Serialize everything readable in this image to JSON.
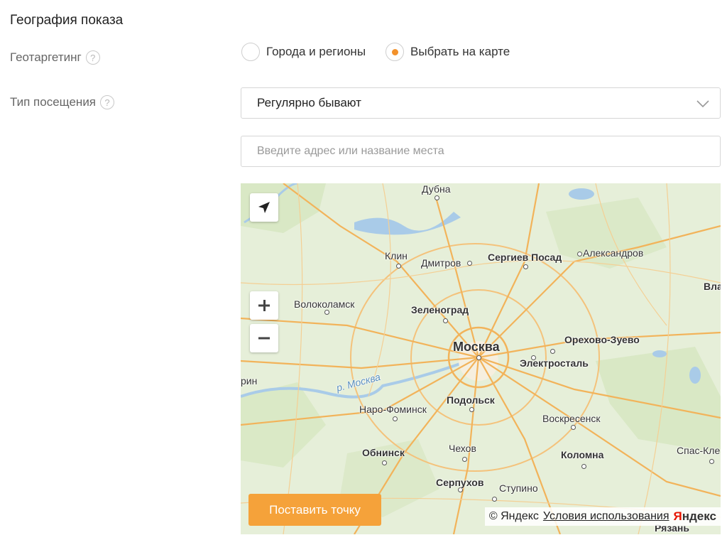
{
  "section": {
    "title": "География показа"
  },
  "geotargeting": {
    "label": "Геотаргетинг",
    "help": "?",
    "options": [
      {
        "label": "Города и регионы",
        "checked": false
      },
      {
        "label": "Выбрать на карте",
        "checked": true
      }
    ]
  },
  "visit_type": {
    "label": "Тип посещения",
    "help": "?",
    "selected": "Регулярно бывают"
  },
  "address": {
    "placeholder": "Введите адрес или название места",
    "value": ""
  },
  "map": {
    "place_point_label": "Поставить точку",
    "attribution_prefix": "© Яндекс",
    "terms_link": "Условия использования",
    "logo_first": "Я",
    "logo_rest": "ндекс",
    "river_label": "р. Москва",
    "cities": {
      "dubna": "Дубна",
      "klin": "Клин",
      "dmitrov": "Дмитров",
      "sergiev_posad": "Сергиев Посад",
      "aleksandrov": "Александров",
      "vla": "Вла",
      "volokolamsk": "Волоколамск",
      "zelenograd": "Зеленоград",
      "moskva": "Москва",
      "orekhovo": "Орехово-Зуево",
      "elektrostal": "Электросталь",
      "rin": "рин",
      "naro": "Наро-Фоминск",
      "podolsk": "Подольск",
      "voskresensk": "Воскресенск",
      "obninsk": "Обнинск",
      "chekhov": "Чехов",
      "kolomna": "Коломна",
      "spas": "Спас-Кле",
      "serpukhov": "Серпухов",
      "stupino": "Ступино",
      "ryazan": "Рязань"
    }
  },
  "colors": {
    "accent": "#f3922b",
    "button": "#f5a23a",
    "map_bg": "#e6efd9",
    "road": "#f2b35a"
  }
}
